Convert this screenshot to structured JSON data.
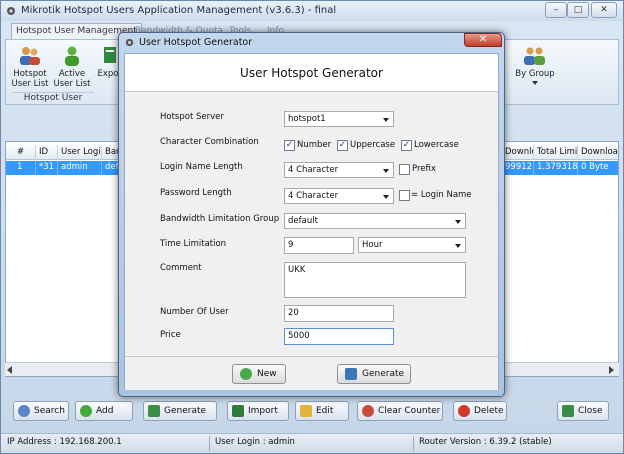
{
  "app": {
    "title": "Mikrotik Hotspot Users Application Management (v3.6.3) - final",
    "window_buttons": [
      "–",
      "□",
      "✕"
    ]
  },
  "ribbon": {
    "tabs": [
      "Hotspot User Management",
      "Bandwidth & Quota",
      "Tools",
      "Info"
    ],
    "buttons": [
      {
        "label": "Hotspot User List",
        "icon": "users-icon"
      },
      {
        "label": "Active User List",
        "icon": "active-user-icon"
      },
      {
        "label": "Expo",
        "icon": "export-icon"
      },
      {
        "label": "By Group",
        "icon": "group-icon"
      }
    ],
    "group_label": "Hotspot User"
  },
  "grid": {
    "columns": [
      "#",
      "ID",
      "User Login",
      "Ban",
      "Downloa",
      "Total Limi",
      "Downloa"
    ],
    "rows": [
      [
        "1",
        "*31",
        "admin",
        "defa",
        "99912",
        "1.379318",
        "0 Byte"
      ]
    ]
  },
  "toolbar": {
    "buttons": [
      "Search",
      "Add",
      "Generate",
      "Import",
      "Edit",
      "Clear Counter",
      "Delete",
      "Close"
    ]
  },
  "status": {
    "ip": "IP Address : 192.168.200.1",
    "user": "User Login : admin",
    "router": "Router Version : 6.39.2 (stable)"
  },
  "dialog": {
    "title": "User Hotspot Generator",
    "heading": "User Hotspot Generator",
    "close_glyph": "✕",
    "fields": {
      "hotspot_server": {
        "label": "Hotspot Server",
        "value": "hotspot1"
      },
      "char_combination": {
        "label": "Character Combination",
        "options": [
          {
            "label": "Number",
            "checked": true
          },
          {
            "label": "Uppercase",
            "checked": true
          },
          {
            "label": "Lowercase",
            "checked": true
          }
        ]
      },
      "login_length": {
        "label": "Login Name Length",
        "value": "4 Character",
        "prefix_label": "Prefix",
        "prefix_checked": false
      },
      "password_length": {
        "label": "Password Length",
        "value": "4 Character",
        "same_label": "= Login Name",
        "same_checked": false
      },
      "bandwidth_group": {
        "label": "Bandwidth Limitation Group",
        "value": "default"
      },
      "time_limitation": {
        "label": "Time Limitation",
        "value": "9",
        "unit": "Hour"
      },
      "comment": {
        "label": "Comment",
        "value": "UKK"
      },
      "number_of_user": {
        "label": "Number Of User",
        "value": "20"
      },
      "price": {
        "label": "Price",
        "value": "5000"
      }
    },
    "buttons": {
      "new": "New",
      "generate": "Generate"
    }
  }
}
